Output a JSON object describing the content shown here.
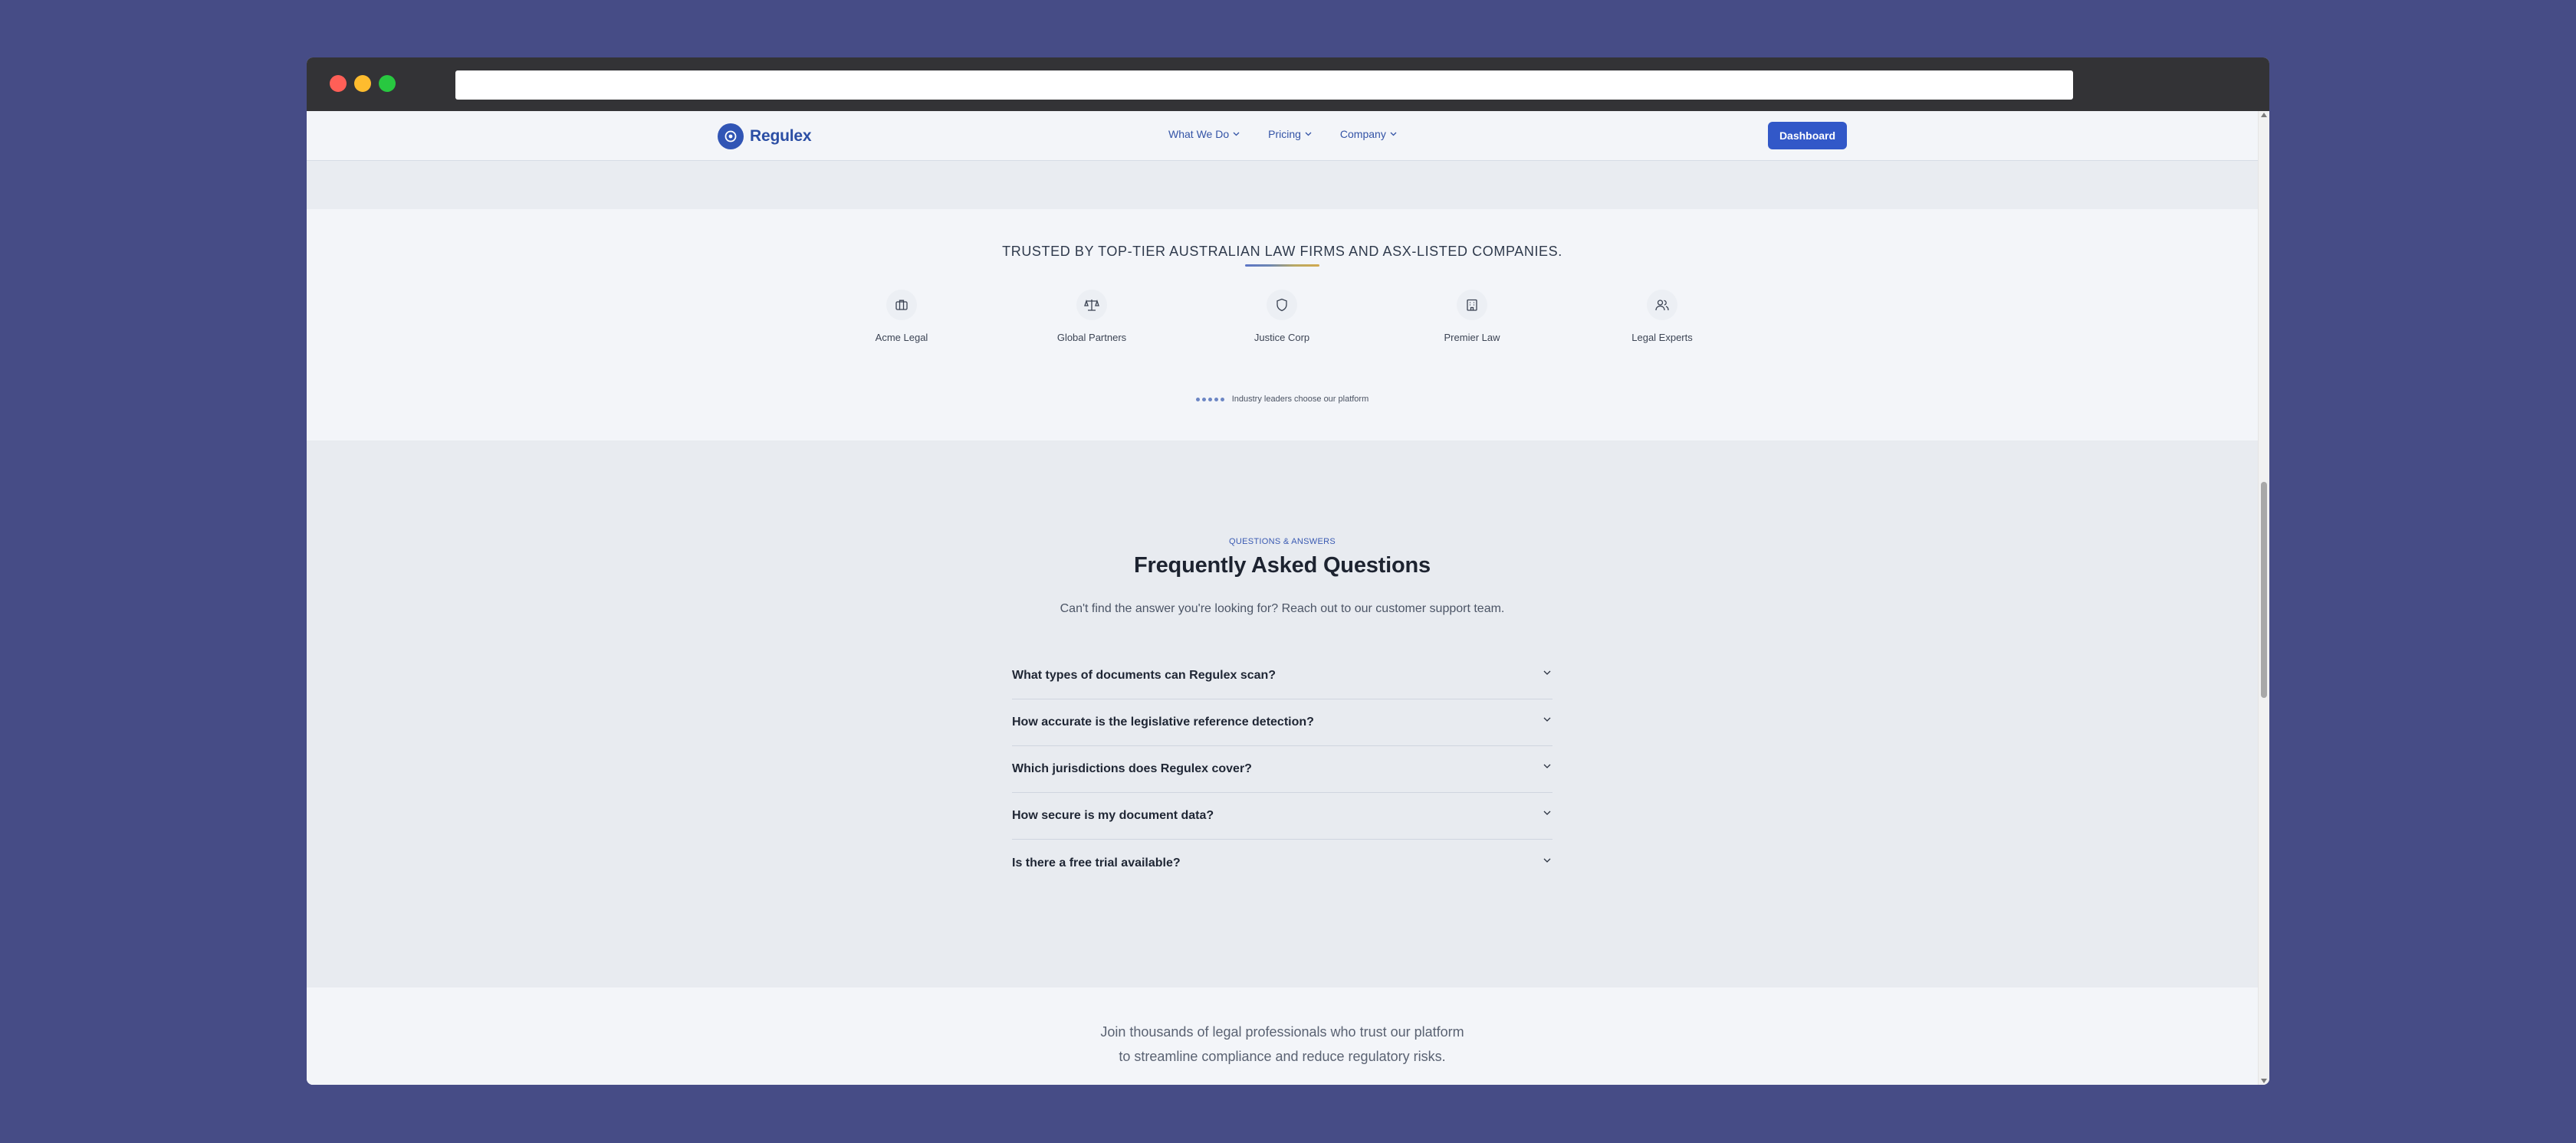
{
  "nav": {
    "brand": "Regulex",
    "links": [
      {
        "label": "What We Do"
      },
      {
        "label": "Pricing"
      },
      {
        "label": "Company"
      }
    ],
    "dashboard_label": "Dashboard"
  },
  "trusted": {
    "title": "TRUSTED BY TOP-TIER AUSTRALIAN LAW FIRMS AND ASX-LISTED COMPANIES.",
    "partners": [
      {
        "name": "Acme Legal",
        "icon": "briefcase-icon"
      },
      {
        "name": "Global Partners",
        "icon": "scale-icon"
      },
      {
        "name": "Justice Corp",
        "icon": "shield-icon"
      },
      {
        "name": "Premier Law",
        "icon": "building-icon"
      },
      {
        "name": "Legal Experts",
        "icon": "users-icon"
      }
    ],
    "tagline": "Industry leaders choose our platform"
  },
  "faq": {
    "eyebrow": "QUESTIONS & ANSWERS",
    "title": "Frequently Asked Questions",
    "subtitle": "Can't find the answer you're looking for? Reach out to our customer support team.",
    "items": [
      {
        "question": "What types of documents can Regulex scan?"
      },
      {
        "question": "How accurate is the legislative reference detection?"
      },
      {
        "question": "Which jurisdictions does Regulex cover?"
      },
      {
        "question": "How secure is my document data?"
      },
      {
        "question": "Is there a free trial available?"
      }
    ]
  },
  "join": {
    "line1": "Join thousands of legal professionals who trust our platform",
    "line2": "to streamline compliance and reduce regulatory risks."
  },
  "colors": {
    "page_background": "#464c86",
    "brand_blue": "#3258c8",
    "surface": "#f3f5f9",
    "section_alt": "#e8ebf0"
  }
}
